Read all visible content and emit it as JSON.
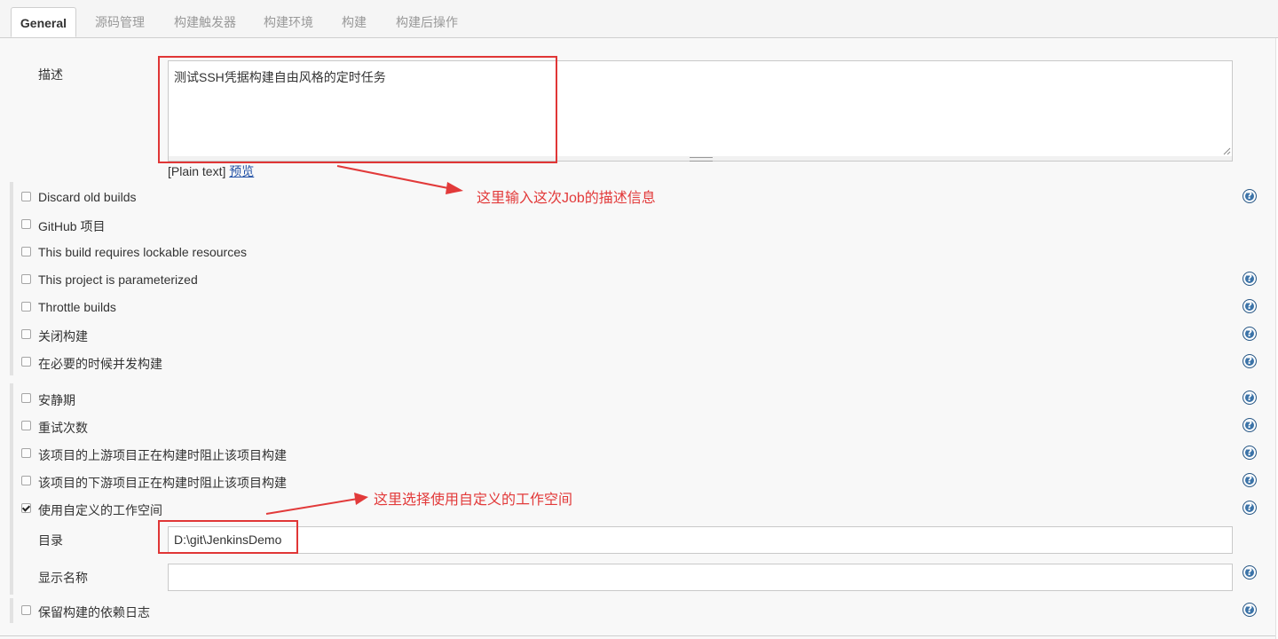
{
  "tabs": [
    {
      "label": "General",
      "active": true
    },
    {
      "label": "源码管理",
      "active": false
    },
    {
      "label": "构建触发器",
      "active": false
    },
    {
      "label": "构建环境",
      "active": false
    },
    {
      "label": "构建",
      "active": false
    },
    {
      "label": "构建后操作",
      "active": false
    }
  ],
  "description": {
    "label": "描述",
    "value": "测试SSH凭据构建自由风格的定时任务",
    "format": "[Plain text]",
    "preview_link": "预览"
  },
  "options_group1": [
    {
      "label": "Discard old builds",
      "checked": false,
      "help": true
    },
    {
      "label": "GitHub 项目",
      "checked": false,
      "help": false
    },
    {
      "label": "This build requires lockable resources",
      "checked": false,
      "help": false
    },
    {
      "label": "This project is parameterized",
      "checked": false,
      "help": true
    },
    {
      "label": "Throttle builds",
      "checked": false,
      "help": true
    },
    {
      "label": "关闭构建",
      "checked": false,
      "help": true
    },
    {
      "label": "在必要的时候并发构建",
      "checked": false,
      "help": true
    }
  ],
  "options_group2": [
    {
      "label": "安静期",
      "checked": false,
      "help": true
    },
    {
      "label": "重试次数",
      "checked": false,
      "help": true
    },
    {
      "label": "该项目的上游项目正在构建时阻止该项目构建",
      "checked": false,
      "help": true
    },
    {
      "label": "该项目的下游项目正在构建时阻止该项目构建",
      "checked": false,
      "help": true
    },
    {
      "label": "使用自定义的工作空间",
      "checked": true,
      "help": true
    }
  ],
  "workspace": {
    "directory_label": "目录",
    "directory_value": "D:\\git\\JenkinsDemo",
    "display_name_label": "显示名称",
    "display_name_value": ""
  },
  "keep_log": {
    "label": "保留构建的依赖日志",
    "checked": false,
    "help": true
  },
  "help_glyph": "?",
  "annotations": {
    "description_note": "这里输入这次Job的描述信息",
    "workspace_note": "这里选择使用自定义的工作空间"
  },
  "colors": {
    "annotation_red": "#e23a3a",
    "help_blue": "#3b73a8",
    "link_blue": "#2352a6"
  }
}
